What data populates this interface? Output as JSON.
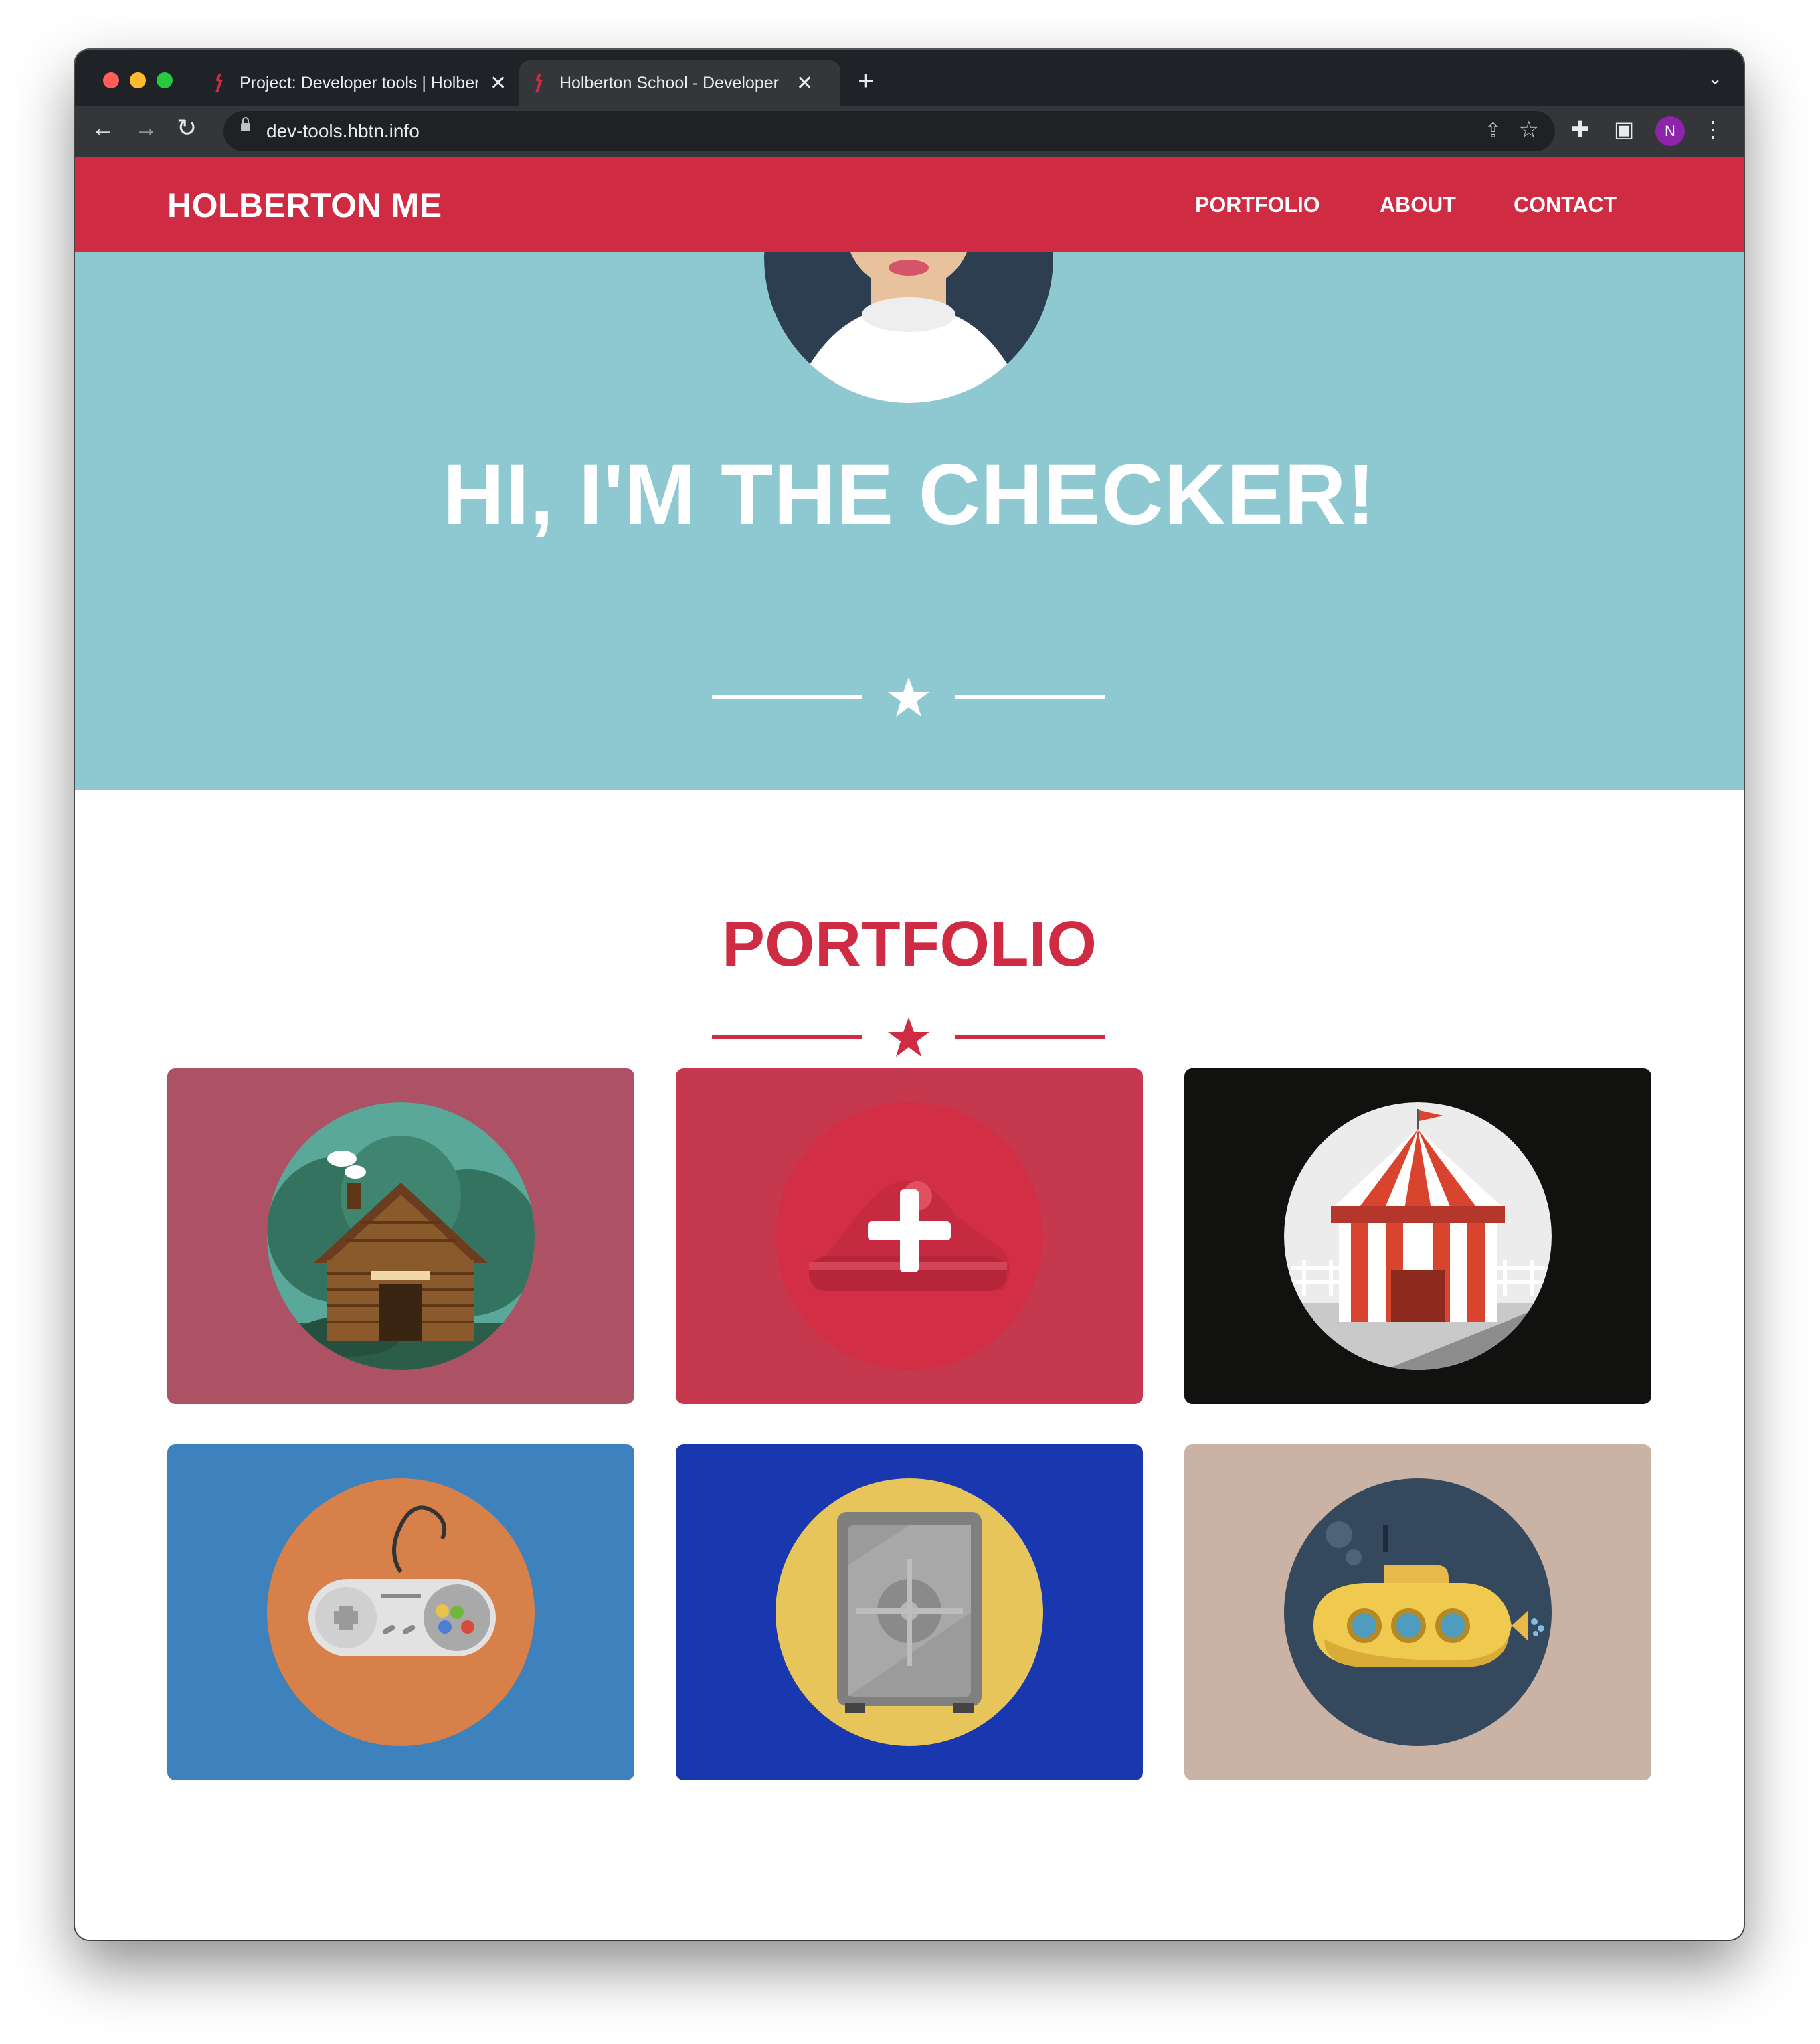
{
  "browser": {
    "tabs": [
      {
        "title": "Project: Developer tools | Holberton School Intranet",
        "active": false
      },
      {
        "title": "Holberton School - Developer tools",
        "active": true
      }
    ],
    "new_tab_label": "+",
    "address": {
      "url": "dev-tools.hbtn.info"
    },
    "profile_initial": "N"
  },
  "navbar": {
    "brand": "HOLBERTON ME",
    "links": [
      "PORTFOLIO",
      "ABOUT",
      "CONTACT"
    ]
  },
  "hero": {
    "title": "HI, I'M THE CHECKER!"
  },
  "portfolio": {
    "title": "PORTFOLIO",
    "items": [
      {
        "icon": "cabin-icon",
        "bg": "#ad5264"
      },
      {
        "icon": "cake-icon",
        "bg": "#c5384d"
      },
      {
        "icon": "circus-tent-icon",
        "bg": "#11110f"
      },
      {
        "icon": "game-controller-icon",
        "bg": "#3d82bd"
      },
      {
        "icon": "safe-icon",
        "bg": "#1938b0"
      },
      {
        "icon": "submarine-icon",
        "bg": "#cab2a5"
      }
    ]
  },
  "colors": {
    "primary": "#cf2b43",
    "hero_bg": "#8ec9d2",
    "white": "#ffffff"
  }
}
